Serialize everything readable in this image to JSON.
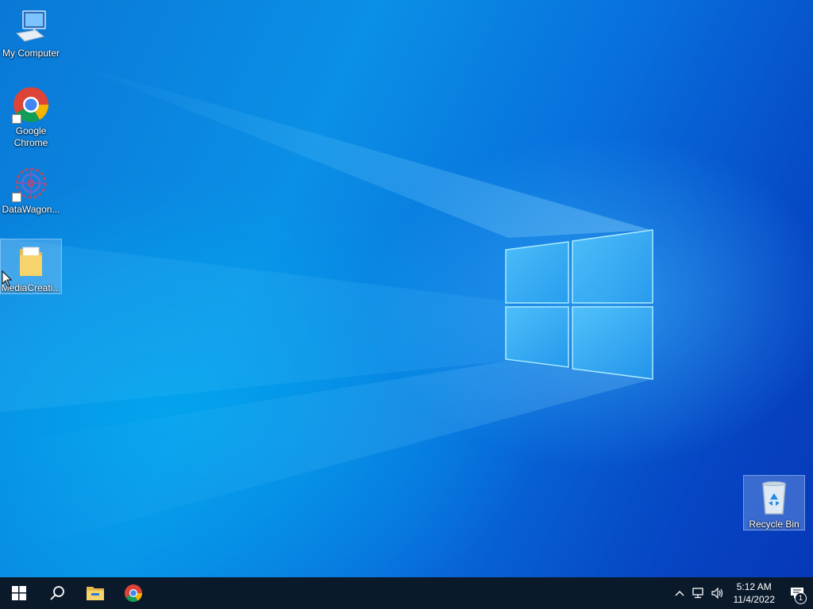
{
  "desktop": {
    "icons": [
      {
        "id": "my-computer",
        "label": "My Computer"
      },
      {
        "id": "google-chrome",
        "label": "Google Chrome"
      },
      {
        "id": "datawagon",
        "label": "DataWagon..."
      },
      {
        "id": "mediacreation",
        "label": "MediaCreati..."
      },
      {
        "id": "recycle-bin",
        "label": "Recycle Bin"
      }
    ]
  },
  "taskbar": {
    "start_icon": "windows-logo-icon",
    "search_icon": "search-icon",
    "pinned": [
      "file-explorer-icon",
      "chrome-icon"
    ],
    "tray": {
      "icons": [
        "chevron-up-icon",
        "network-icon",
        "volume-icon"
      ],
      "time": "5:12 AM",
      "date": "11/4/2022",
      "notification_count": "1"
    }
  },
  "colors": {
    "taskbar_bg": "#0b1a2b",
    "wallpaper_blue": "#0a63d8"
  }
}
